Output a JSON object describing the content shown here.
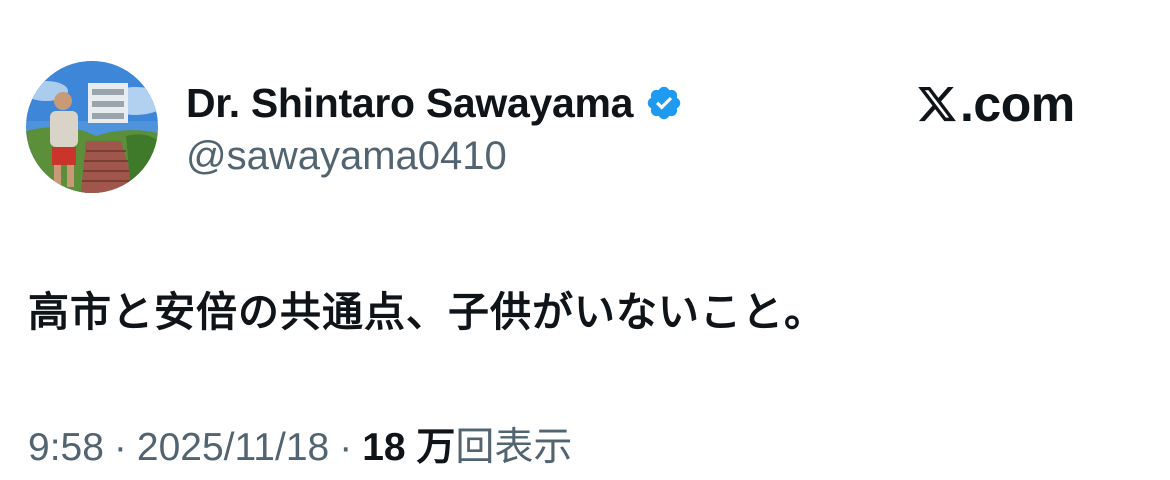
{
  "author": {
    "display_name": "Dr. Shintaro Sawayama",
    "handle": "@sawayama0410",
    "verified": true,
    "verified_color": "#1d9bf0"
  },
  "brand": {
    "logo_icon": "x-logo-icon",
    "domain": ".com"
  },
  "tweet": {
    "text": "高市と安倍の共通点、子供がいないこと。"
  },
  "meta": {
    "time": "9:58",
    "separator": "·",
    "date": "2025/11/18",
    "views_count": "18 万",
    "views_label": "回表示"
  },
  "colors": {
    "text_primary": "#0f1419",
    "text_secondary": "#536471",
    "background": "#ffffff"
  }
}
